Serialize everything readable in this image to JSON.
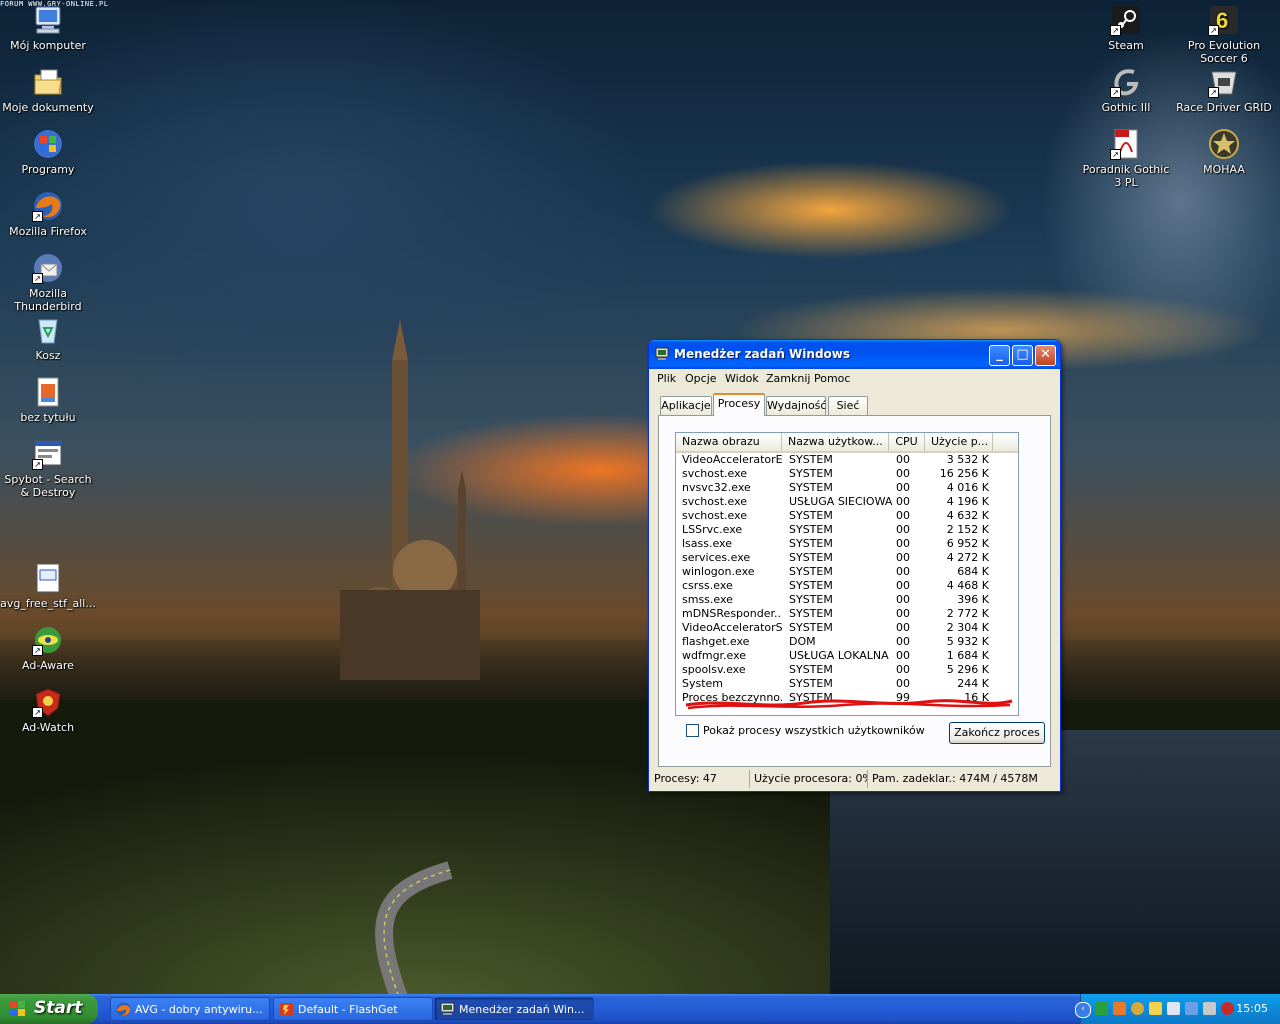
{
  "watermark": "FORUM WWW.GRY-ONLINE.PL",
  "desktop_icons_left": [
    {
      "label": "Mój komputer",
      "icon": "my-computer-icon",
      "shortcut": false
    },
    {
      "label": "Moje dokumenty",
      "icon": "my-documents-icon",
      "shortcut": false
    },
    {
      "label": "Programy",
      "icon": "windows-logo-icon",
      "shortcut": false
    },
    {
      "label": "Mozilla Firefox",
      "icon": "firefox-icon",
      "shortcut": true
    },
    {
      "label": "Mozilla Thunderbird",
      "icon": "thunderbird-icon",
      "shortcut": true
    },
    {
      "label": "Kosz",
      "icon": "recycle-bin-icon",
      "shortcut": false
    },
    {
      "label": "bez tytułu",
      "icon": "image-file-icon",
      "shortcut": false
    },
    {
      "label": "Spybot - Search & Destroy",
      "icon": "spybot-icon",
      "shortcut": true
    },
    {
      "label": "avg_free_stf_all...",
      "icon": "installer-icon",
      "shortcut": false
    },
    {
      "label": "Ad-Aware",
      "icon": "ad-aware-icon",
      "shortcut": true
    },
    {
      "label": "Ad-Watch",
      "icon": "ad-watch-icon",
      "shortcut": true
    }
  ],
  "desktop_icons_right": [
    {
      "label": "Steam",
      "icon": "steam-icon",
      "shortcut": true
    },
    {
      "label": "Pro Evolution Soccer 6",
      "icon": "pes6-icon",
      "shortcut": true
    },
    {
      "label": "Gothic III",
      "icon": "gothic-icon",
      "shortcut": true
    },
    {
      "label": "Race Driver GRID",
      "icon": "grid-icon",
      "shortcut": true
    },
    {
      "label": "Poradnik Gothic 3 PL",
      "icon": "pdf-icon",
      "shortcut": true
    },
    {
      "label": "MOHAA",
      "icon": "mohaa-icon",
      "shortcut": false
    }
  ],
  "window": {
    "title": "Menedżer zadań Windows",
    "menu": [
      "Plik",
      "Opcje",
      "Widok",
      "Zamknij",
      "Pomoc"
    ],
    "tabs": [
      "Aplikacje",
      "Procesy",
      "Wydajność",
      "Sieć"
    ],
    "selected_tab": "Procesy",
    "columns": [
      "Nazwa obrazu",
      "Nazwa użytkow...",
      "CPU",
      "Użycie p..."
    ],
    "processes": [
      {
        "name": "VideoAcceleratorE...",
        "user": "SYSTEM",
        "cpu": "00",
        "mem": "3 532 K"
      },
      {
        "name": "svchost.exe",
        "user": "SYSTEM",
        "cpu": "00",
        "mem": "16 256 K"
      },
      {
        "name": "nvsvc32.exe",
        "user": "SYSTEM",
        "cpu": "00",
        "mem": "4 016 K"
      },
      {
        "name": "svchost.exe",
        "user": "USŁUGA SIECIOWA",
        "cpu": "00",
        "mem": "4 196 K"
      },
      {
        "name": "svchost.exe",
        "user": "SYSTEM",
        "cpu": "00",
        "mem": "4 632 K"
      },
      {
        "name": "LSSrvc.exe",
        "user": "SYSTEM",
        "cpu": "00",
        "mem": "2 152 K"
      },
      {
        "name": "lsass.exe",
        "user": "SYSTEM",
        "cpu": "00",
        "mem": "6 952 K"
      },
      {
        "name": "services.exe",
        "user": "SYSTEM",
        "cpu": "00",
        "mem": "4 272 K"
      },
      {
        "name": "winlogon.exe",
        "user": "SYSTEM",
        "cpu": "00",
        "mem": "684 K"
      },
      {
        "name": "csrss.exe",
        "user": "SYSTEM",
        "cpu": "00",
        "mem": "4 468 K"
      },
      {
        "name": "smss.exe",
        "user": "SYSTEM",
        "cpu": "00",
        "mem": "396 K"
      },
      {
        "name": "mDNSResponder....",
        "user": "SYSTEM",
        "cpu": "00",
        "mem": "2 772 K"
      },
      {
        "name": "VideoAcceleratorS...",
        "user": "SYSTEM",
        "cpu": "00",
        "mem": "2 304 K"
      },
      {
        "name": "flashget.exe",
        "user": "DOM",
        "cpu": "00",
        "mem": "5 932 K"
      },
      {
        "name": "wdfmgr.exe",
        "user": "USŁUGA LOKALNA",
        "cpu": "00",
        "mem": "1 684 K"
      },
      {
        "name": "spoolsv.exe",
        "user": "SYSTEM",
        "cpu": "00",
        "mem": "5 296 K"
      },
      {
        "name": "System",
        "user": "SYSTEM",
        "cpu": "00",
        "mem": "244 K"
      },
      {
        "name": "Proces bezczynno...",
        "user": "SYSTEM",
        "cpu": "99",
        "mem": "16 K"
      }
    ],
    "show_all_label": "Pokaż procesy wszystkich użytkowników",
    "end_process_label": "Zakończ proces",
    "status": {
      "processes": "Procesy: 47",
      "cpu": "Użycie procesora: 0%",
      "memory": "Pam. zadeklar.: 474M / 4578M"
    }
  },
  "taskbar": {
    "start_label": "Start",
    "buttons": [
      {
        "label": "AVG - dobry antywiru...",
        "icon": "firefox-icon",
        "active": false
      },
      {
        "label": "Default - FlashGet",
        "icon": "flashget-icon",
        "active": false
      },
      {
        "label": "Menedżer zadań Win...",
        "icon": "task-manager-icon",
        "active": true
      }
    ],
    "clock": "15:05"
  },
  "colors": {
    "xp_blue": "#0053ee",
    "start_green": "#3c9a3c",
    "tab_highlight": "#e68b2c",
    "red_scribble": "#e01010"
  }
}
